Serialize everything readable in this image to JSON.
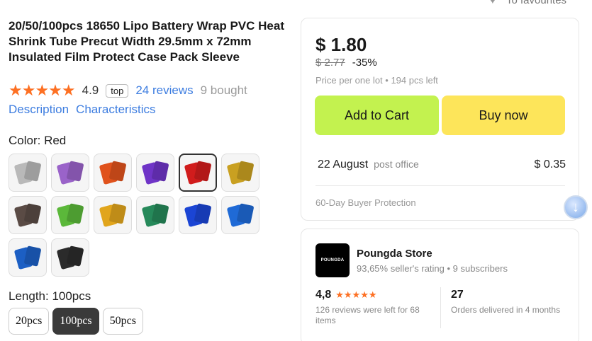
{
  "favourites": {
    "label": "To favourites",
    "icon": "heart-icon"
  },
  "product": {
    "title": "20/50/100pcs 18650 Lipo Battery Wrap PVC Heat Shrink Tube Precut Width 29.5mm x 72mm Insulated Film Protect Case Pack Sleeve",
    "stars": "★★★★★",
    "rating": "4.9",
    "badge": "top",
    "reviews": "24 reviews",
    "bought": "9 bought"
  },
  "tabs": {
    "description": "Description",
    "characteristics": "Characteristics"
  },
  "color": {
    "label": "Color: Red",
    "swatches": [
      {
        "name": "Gray",
        "hex": "#b9b9b9",
        "selected": false
      },
      {
        "name": "Purple",
        "hex": "#9a63c9",
        "selected": false
      },
      {
        "name": "Orange",
        "hex": "#e0521c",
        "selected": false
      },
      {
        "name": "Violet",
        "hex": "#6f34c7",
        "selected": false
      },
      {
        "name": "Red",
        "hex": "#d11c1c",
        "selected": true
      },
      {
        "name": "Gold",
        "hex": "#c9a021",
        "selected": false
      },
      {
        "name": "Black-Silver",
        "hex": "#5a4b45",
        "selected": false
      },
      {
        "name": "Green",
        "hex": "#5bb83a",
        "selected": false
      },
      {
        "name": "Yellow-Gold",
        "hex": "#e1a51c",
        "selected": false
      },
      {
        "name": "Dark Green",
        "hex": "#26895a",
        "selected": false
      },
      {
        "name": "Blue",
        "hex": "#1b45d4",
        "selected": false
      },
      {
        "name": "Sky Blue",
        "hex": "#1f6ad6",
        "selected": false
      },
      {
        "name": "Blue-Black",
        "hex": "#1c5fc4",
        "selected": false
      },
      {
        "name": "Black",
        "hex": "#2b2b2b",
        "selected": false
      }
    ]
  },
  "length": {
    "label": "Length: 100pcs",
    "options": [
      {
        "label": "20pcs",
        "selected": false
      },
      {
        "label": "100pcs",
        "selected": true
      },
      {
        "label": "50pcs",
        "selected": false
      }
    ]
  },
  "pricing": {
    "price": "$ 1.80",
    "old_price": "$ 2.77",
    "discount": "-35%",
    "lot_info": "Price per one lot • 194 pcs left",
    "add_to_cart": "Add to Cart",
    "buy_now": "Buy now",
    "shipping_date": "22 August",
    "shipping_method": "post office",
    "shipping_cost": "$ 0.35",
    "protection": "60-Day Buyer Protection"
  },
  "store": {
    "logo_text": "POUNGDA",
    "name": "Poungda Store",
    "meta": "93,65% seller's rating • 9 subscribers",
    "rating": "4,8",
    "rating_stars": "★★★★★",
    "rating_desc": "126 reviews were left for 68 items",
    "orders": "27",
    "orders_desc": "Orders delivered in 4 months"
  },
  "colors": {
    "accent_link": "#3d7de0",
    "cart_button": "#c3f24f",
    "buy_button": "#fde55a",
    "star": "#fd7023"
  }
}
